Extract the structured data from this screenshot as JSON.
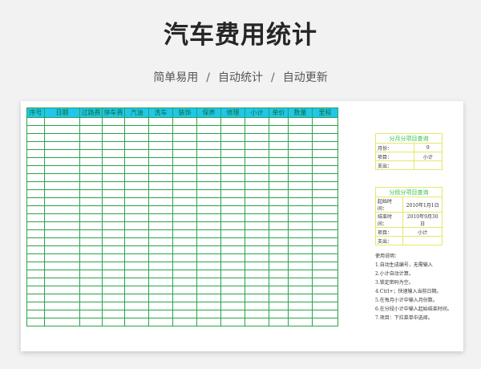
{
  "page": {
    "title": "汽车费用统计",
    "tagline": [
      "简单易用",
      "自动统计",
      "自动更新"
    ],
    "separator": "/"
  },
  "table": {
    "headers": [
      "序号",
      "日期",
      "过路费",
      "停车费",
      "汽油",
      "洗车",
      "装饰",
      "保养",
      "修理",
      "小计",
      "单价",
      "数量",
      "里程"
    ]
  },
  "monthly_query": {
    "title": "分月分项目查询",
    "rows": [
      {
        "label": "月份：",
        "value": "9"
      },
      {
        "label": "项目：",
        "value": "小计"
      },
      {
        "label": "支出：",
        "value": ""
      }
    ]
  },
  "range_query": {
    "title": "分段分项目查询",
    "rows": [
      {
        "label": "起始时间：",
        "value": "2010年1月1日"
      },
      {
        "label": "结束时间：",
        "value": "2010年9月30日"
      },
      {
        "label": "项目：",
        "value": "小计"
      },
      {
        "label": "支出：",
        "value": ""
      }
    ]
  },
  "instructions": {
    "title": "使用说明：",
    "items": [
      "1.自动生成编号，无需输入",
      "2.小计自动计算。",
      "3.锁定密码为空。",
      "4.Ctrl+；快速输入当前日期。",
      "5.在每月小计中输入月份数。",
      "6.在分段小计中输入起始结束时间。",
      "7.项目：下拉菜单中选择。"
    ]
  },
  "colors": {
    "header_fill": "#1fc6ee",
    "grid_line": "#2aa34a",
    "query_border": "#e7e76a",
    "query_title": "#2fc24a"
  }
}
